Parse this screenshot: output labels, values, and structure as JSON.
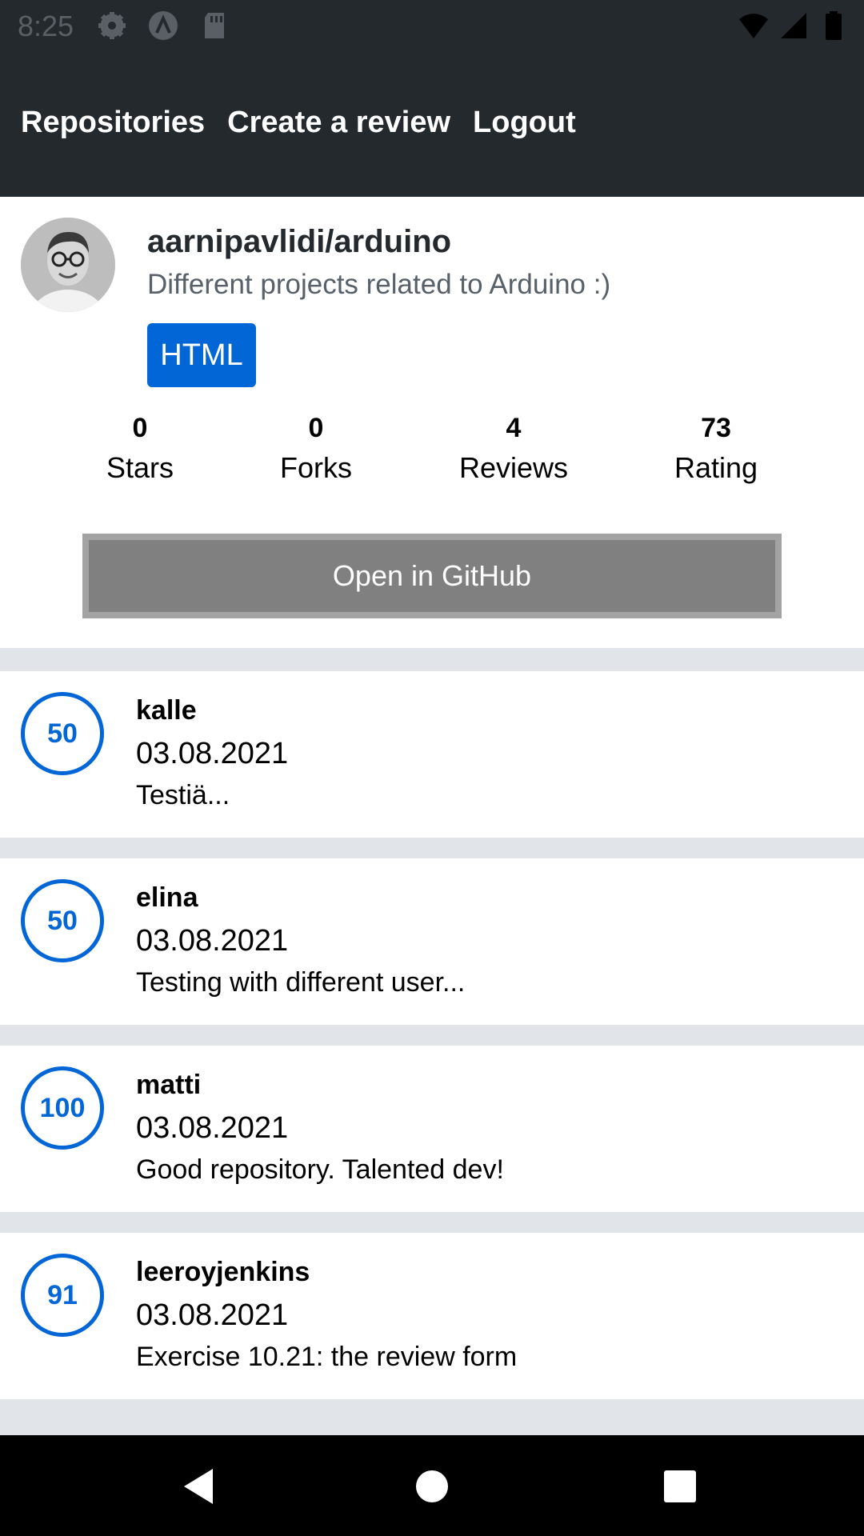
{
  "status_bar": {
    "time": "8:25",
    "left_icons": [
      "gear-icon",
      "app-icon",
      "sd-card-icon"
    ],
    "right_icons": [
      "wifi-icon",
      "signal-icon",
      "battery-icon"
    ]
  },
  "tabs": [
    {
      "label": "Repositories"
    },
    {
      "label": "Create a review"
    },
    {
      "label": "Logout"
    }
  ],
  "repository": {
    "full_name": "aarnipavlidi/arduino",
    "description": "Different projects related to Arduino :)",
    "language": "HTML",
    "stats": [
      {
        "value": "0",
        "label": "Stars"
      },
      {
        "value": "0",
        "label": "Forks"
      },
      {
        "value": "4",
        "label": "Reviews"
      },
      {
        "value": "73",
        "label": "Rating"
      }
    ],
    "github_button_label": "Open in GitHub"
  },
  "reviews": [
    {
      "rating": "50",
      "user": "kalle",
      "date": "03.08.2021",
      "text": "Testiä..."
    },
    {
      "rating": "50",
      "user": "elina",
      "date": "03.08.2021",
      "text": "Testing with different user..."
    },
    {
      "rating": "100",
      "user": "matti",
      "date": "03.08.2021",
      "text": "Good repository. Talented dev!"
    },
    {
      "rating": "91",
      "user": "leeroyjenkins",
      "date": "03.08.2021",
      "text": "Exercise 10.21: the review form"
    }
  ],
  "nav_bar": {
    "buttons": [
      "back-icon",
      "home-icon",
      "recents-icon"
    ]
  },
  "colors": {
    "app_bar": "#24292e",
    "primary": "#0366d6",
    "background": "#e1e4e8",
    "github_button": "#808080"
  }
}
